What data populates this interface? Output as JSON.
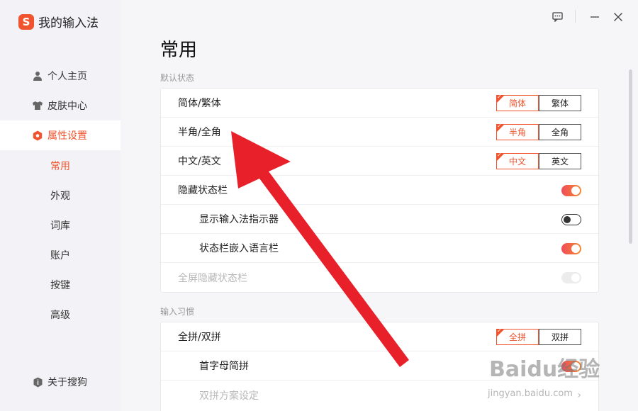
{
  "app": {
    "title": "我的输入法",
    "logo_letter": "S"
  },
  "sidebar": {
    "items": [
      {
        "label": "个人主页",
        "icon": "user-icon"
      },
      {
        "label": "皮肤中心",
        "icon": "shirt-icon"
      },
      {
        "label": "属性设置",
        "icon": "hexagon-icon",
        "active": true
      }
    ],
    "sub_items": [
      "常用",
      "外观",
      "词库",
      "账户",
      "按键",
      "高级"
    ],
    "about_label": "关于搜狗"
  },
  "main": {
    "title": "常用",
    "sections": [
      {
        "label": "默认状态",
        "rows": [
          {
            "label": "简体/繁体",
            "control": "segmented",
            "options": [
              "简体",
              "繁体"
            ],
            "selected": 0
          },
          {
            "label": "半角/全角",
            "control": "segmented",
            "options": [
              "半角",
              "全角"
            ],
            "selected": 0
          },
          {
            "label": "中文/英文",
            "control": "segmented",
            "options": [
              "中文",
              "英文"
            ],
            "selected": 0
          },
          {
            "label": "隐藏状态栏",
            "control": "toggle",
            "value": "on"
          },
          {
            "label": "显示输入法指示器",
            "control": "toggle",
            "value": "off",
            "indent": true
          },
          {
            "label": "状态栏嵌入语言栏",
            "control": "toggle",
            "value": "on",
            "indent": true
          },
          {
            "label": "全屏隐藏状态栏",
            "control": "toggle",
            "value": "disabled"
          }
        ]
      },
      {
        "label": "输入习惯",
        "rows": [
          {
            "label": "全拼/双拼",
            "control": "segmented",
            "options": [
              "全拼",
              "双拼"
            ],
            "selected": 0
          },
          {
            "label": "首字母简拼",
            "control": "toggle",
            "value": "on",
            "indent": true
          },
          {
            "label": "双拼方案设定",
            "control": "chevron",
            "indent": true,
            "disabled": true
          }
        ]
      }
    ]
  },
  "watermark": {
    "text": "Baidu经验",
    "sub": "jingyan.baidu.com"
  },
  "colors": {
    "accent": "#f0532d",
    "annotation_arrow": "#e8202a"
  }
}
